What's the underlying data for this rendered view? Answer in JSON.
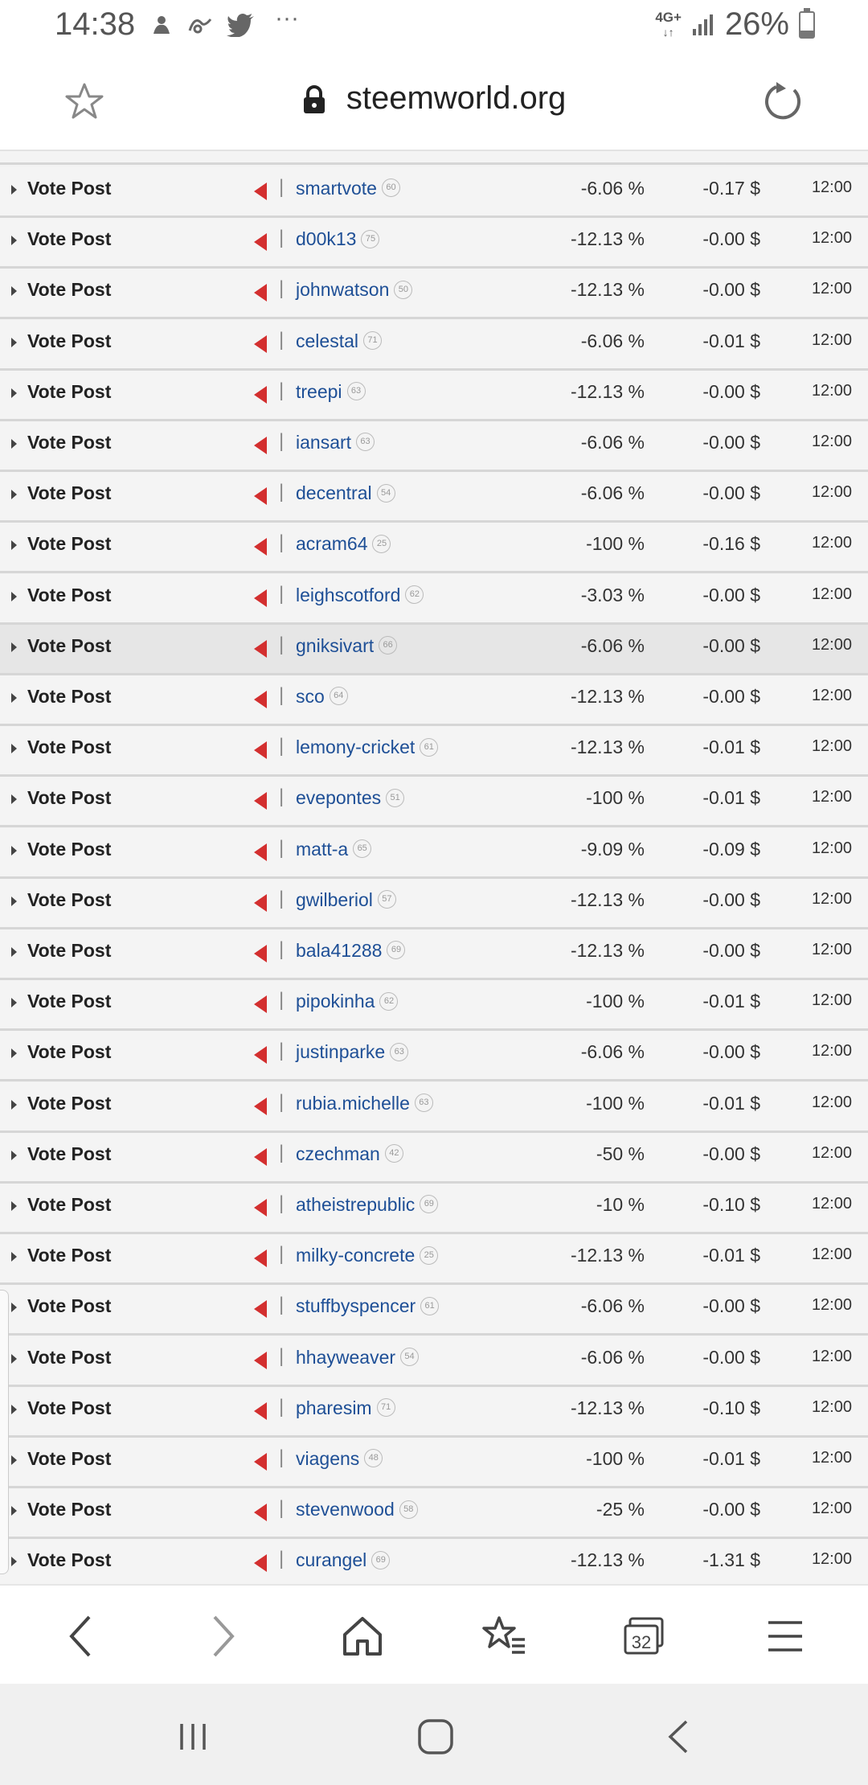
{
  "status_bar": {
    "time": "14:38",
    "network": "4G+",
    "battery": "26%",
    "more": "···",
    "icons": [
      "notification-icon",
      "app-icon",
      "twitter-icon",
      "more-icon",
      "signal-icon",
      "battery-icon"
    ]
  },
  "url_bar": {
    "url": "steemworld.org",
    "icons": [
      "bookmark-star-icon",
      "lock-icon",
      "reload-icon"
    ]
  },
  "rows": [
    {
      "type": "Vote Post",
      "user": "smartvote",
      "rep": "60",
      "percent": "-6.06 %",
      "value": "-0.17 $",
      "time": "12:00"
    },
    {
      "type": "Vote Post",
      "user": "d00k13",
      "rep": "75",
      "percent": "-12.13 %",
      "value": "-0.00 $",
      "time": "12:00"
    },
    {
      "type": "Vote Post",
      "user": "johnwatson",
      "rep": "50",
      "percent": "-12.13 %",
      "value": "-0.00 $",
      "time": "12:00"
    },
    {
      "type": "Vote Post",
      "user": "celestal",
      "rep": "71",
      "percent": "-6.06 %",
      "value": "-0.01 $",
      "time": "12:00"
    },
    {
      "type": "Vote Post",
      "user": "treepi",
      "rep": "63",
      "percent": "-12.13 %",
      "value": "-0.00 $",
      "time": "12:00"
    },
    {
      "type": "Vote Post",
      "user": "iansart",
      "rep": "63",
      "percent": "-6.06 %",
      "value": "-0.00 $",
      "time": "12:00"
    },
    {
      "type": "Vote Post",
      "user": "decentral",
      "rep": "54",
      "percent": "-6.06 %",
      "value": "-0.00 $",
      "time": "12:00"
    },
    {
      "type": "Vote Post",
      "user": "acram64",
      "rep": "25",
      "percent": "-100 %",
      "value": "-0.16 $",
      "time": "12:00"
    },
    {
      "type": "Vote Post",
      "user": "leighscotford",
      "rep": "62",
      "percent": "-3.03 %",
      "value": "-0.00 $",
      "time": "12:00"
    },
    {
      "type": "Vote Post",
      "user": "gniksivart",
      "rep": "66",
      "percent": "-6.06 %",
      "value": "-0.00 $",
      "time": "12:00",
      "highlight": true
    },
    {
      "type": "Vote Post",
      "user": "sco",
      "rep": "64",
      "percent": "-12.13 %",
      "value": "-0.00 $",
      "time": "12:00"
    },
    {
      "type": "Vote Post",
      "user": "lemony-cricket",
      "rep": "61",
      "percent": "-12.13 %",
      "value": "-0.01 $",
      "time": "12:00"
    },
    {
      "type": "Vote Post",
      "user": "evepontes",
      "rep": "51",
      "percent": "-100 %",
      "value": "-0.01 $",
      "time": "12:00"
    },
    {
      "type": "Vote Post",
      "user": "matt-a",
      "rep": "65",
      "percent": "-9.09 %",
      "value": "-0.09 $",
      "time": "12:00"
    },
    {
      "type": "Vote Post",
      "user": "gwilberiol",
      "rep": "57",
      "percent": "-12.13 %",
      "value": "-0.00 $",
      "time": "12:00"
    },
    {
      "type": "Vote Post",
      "user": "bala41288",
      "rep": "69",
      "percent": "-12.13 %",
      "value": "-0.00 $",
      "time": "12:00"
    },
    {
      "type": "Vote Post",
      "user": "pipokinha",
      "rep": "62",
      "percent": "-100 %",
      "value": "-0.01 $",
      "time": "12:00"
    },
    {
      "type": "Vote Post",
      "user": "justinparke",
      "rep": "63",
      "percent": "-6.06 %",
      "value": "-0.00 $",
      "time": "12:00"
    },
    {
      "type": "Vote Post",
      "user": "rubia.michelle",
      "rep": "63",
      "percent": "-100 %",
      "value": "-0.01 $",
      "time": "12:00"
    },
    {
      "type": "Vote Post",
      "user": "czechman",
      "rep": "42",
      "percent": "-50 %",
      "value": "-0.00 $",
      "time": "12:00"
    },
    {
      "type": "Vote Post",
      "user": "atheistrepublic",
      "rep": "69",
      "percent": "-10 %",
      "value": "-0.10 $",
      "time": "12:00"
    },
    {
      "type": "Vote Post",
      "user": "milky-concrete",
      "rep": "25",
      "percent": "-12.13 %",
      "value": "-0.01 $",
      "time": "12:00"
    },
    {
      "type": "Vote Post",
      "user": "stuffbyspencer",
      "rep": "61",
      "percent": "-6.06 %",
      "value": "-0.00 $",
      "time": "12:00"
    },
    {
      "type": "Vote Post",
      "user": "hhayweaver",
      "rep": "54",
      "percent": "-6.06 %",
      "value": "-0.00 $",
      "time": "12:00"
    },
    {
      "type": "Vote Post",
      "user": "pharesim",
      "rep": "71",
      "percent": "-12.13 %",
      "value": "-0.10 $",
      "time": "12:00"
    },
    {
      "type": "Vote Post",
      "user": "viagens",
      "rep": "48",
      "percent": "-100 %",
      "value": "-0.01 $",
      "time": "12:00"
    },
    {
      "type": "Vote Post",
      "user": "stevenwood",
      "rep": "58",
      "percent": "-25 %",
      "value": "-0.00 $",
      "time": "12:00"
    },
    {
      "type": "Vote Post",
      "user": "curangel",
      "rep": "69",
      "percent": "-12.13 %",
      "value": "-1.31 $",
      "time": "12:00"
    }
  ],
  "toolbar": {
    "tabs_count": "32",
    "icons": [
      "back-icon",
      "forward-icon",
      "home-icon",
      "bookmarks-icon",
      "tabs-icon",
      "menu-icon"
    ]
  },
  "nav_bar": {
    "icons": [
      "recent-apps-icon",
      "home-nav-icon",
      "back-nav-icon"
    ]
  }
}
